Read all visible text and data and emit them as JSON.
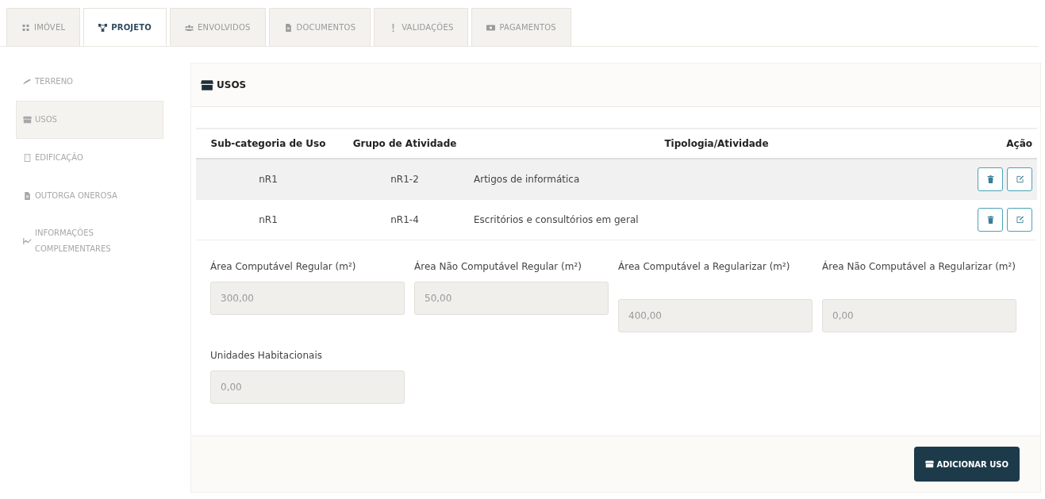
{
  "tabs": [
    {
      "label": "IMÓVEL",
      "kind": "grid",
      "selected": false
    },
    {
      "label": "PROJETO",
      "kind": "nodes",
      "selected": true
    },
    {
      "label": "ENVOLVIDOS",
      "kind": "people",
      "selected": false
    },
    {
      "label": "DOCUMENTOS",
      "kind": "file",
      "selected": false
    },
    {
      "label": "VALIDAÇÕES",
      "kind": "exclamation",
      "selected": false
    },
    {
      "label": "PAGAMENTOS",
      "kind": "money",
      "selected": false
    }
  ],
  "sidebar": {
    "items": [
      {
        "label": "TERRENO",
        "kind": "pencil",
        "selected": false
      },
      {
        "label": "USOS",
        "kind": "store",
        "selected": true
      },
      {
        "label": "EDIFICAÇÃO",
        "kind": "building",
        "selected": false
      },
      {
        "label": "OUTORGA ONEROSA",
        "kind": "file",
        "selected": false
      },
      {
        "label": "INFORMAÇÕES COMPLEMENTARES",
        "kind": "chart",
        "selected": false
      }
    ]
  },
  "panel": {
    "title": "USOS",
    "table": {
      "columns": [
        "Sub-categoria de Uso",
        "Grupo de Atividade",
        "Tipologia/Atividade",
        "Ação"
      ],
      "rows": [
        {
          "cells": [
            "nR1",
            "nR1-2",
            "Artigos de informática"
          ],
          "selected": true
        },
        {
          "cells": [
            "nR1",
            "nR1-4",
            "Escritórios e consultórios em geral"
          ],
          "selected": false
        }
      ]
    },
    "fields": [
      {
        "label": "Área Computável Regular (m²)",
        "value": "300,00"
      },
      {
        "label": "Área Não Computável Regular (m²)",
        "value": "50,00"
      },
      {
        "label": "Área Computável a Regularizar (m²)",
        "value": "400,00"
      },
      {
        "label": "Área Não Computável a Regularizar (m²)",
        "value": "0,00"
      },
      {
        "label": "Unidades Habitacionais",
        "value": "0,00"
      }
    ],
    "button": "ADICIONAR USO"
  }
}
